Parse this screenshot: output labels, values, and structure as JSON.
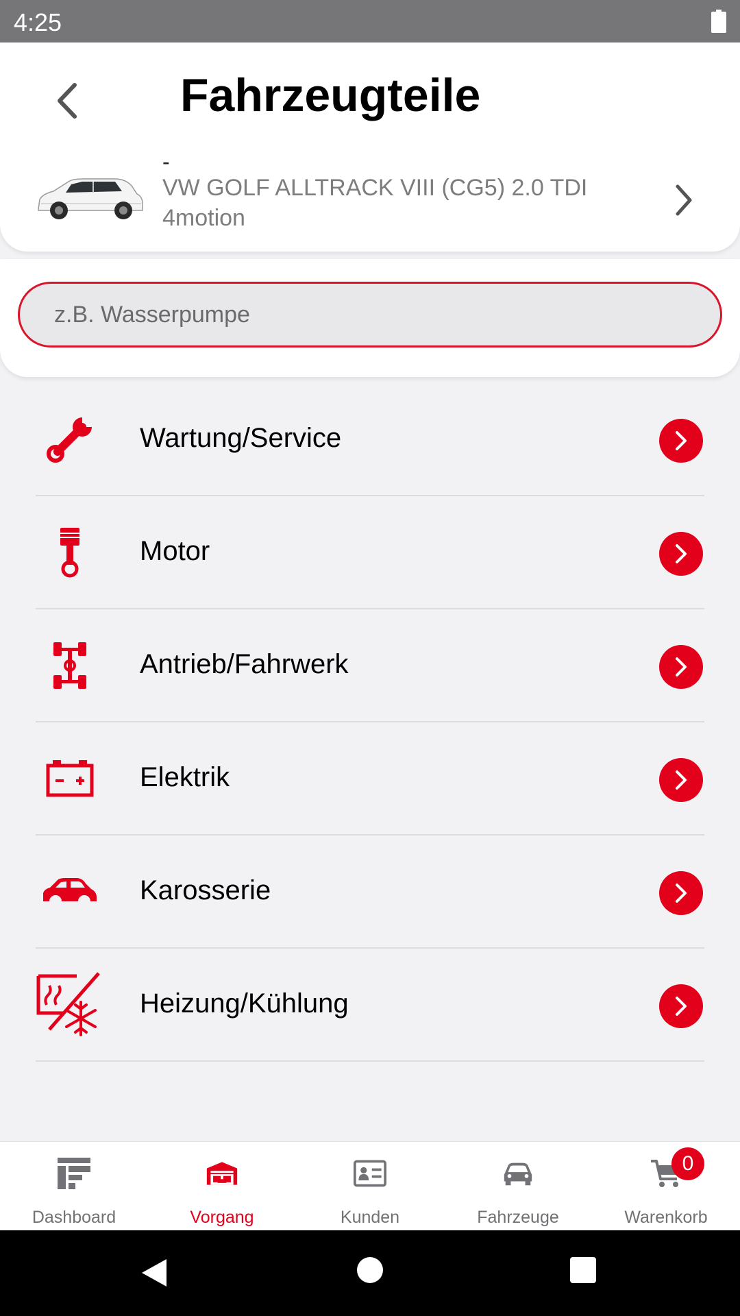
{
  "status_bar": {
    "time": "4:25"
  },
  "header": {
    "title": "Fahrzeugteile"
  },
  "vehicle": {
    "dash": "-",
    "name": "VW GOLF ALLTRACK VIII (CG5) 2.0 TDI 4motion"
  },
  "search": {
    "placeholder": "z.B. Wasserpumpe"
  },
  "categories": [
    {
      "label": "Wartung/Service",
      "icon": "wrench-icon"
    },
    {
      "label": "Motor",
      "icon": "piston-icon"
    },
    {
      "label": "Antrieb/Fahrwerk",
      "icon": "drivetrain-icon"
    },
    {
      "label": "Elektrik",
      "icon": "battery-icon"
    },
    {
      "label": "Karosserie",
      "icon": "car-body-icon"
    },
    {
      "label": "Heizung/Kühlung",
      "icon": "heating-cooling-icon"
    }
  ],
  "bottom_nav": [
    {
      "label": "Dashboard",
      "icon": "dashboard-icon"
    },
    {
      "label": "Vorgang",
      "icon": "garage-icon",
      "active": true
    },
    {
      "label": "Kunden",
      "icon": "contact-card-icon"
    },
    {
      "label": "Fahrzeuge",
      "icon": "car-icon"
    },
    {
      "label": "Warenkorb",
      "icon": "cart-icon",
      "badge": "0"
    }
  ],
  "colors": {
    "accent": "#e3001b",
    "status_bar": "#767578",
    "background": "#f2f1f4"
  }
}
